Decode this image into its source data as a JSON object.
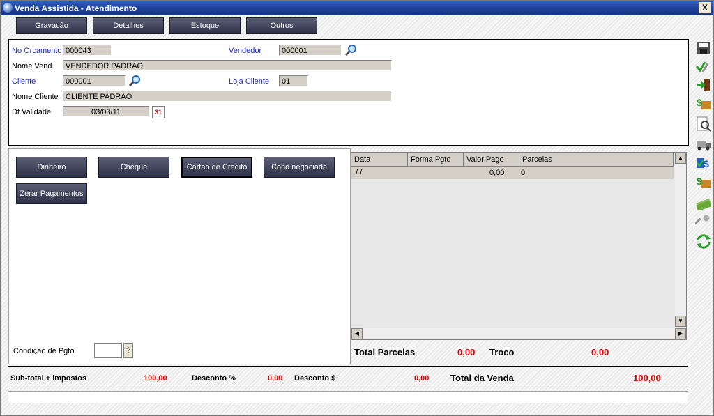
{
  "window": {
    "title": "Venda Assistida - Atendimento",
    "close_label": "X"
  },
  "toolbar": [
    "Gravacão",
    "Detalhes",
    "Estoque",
    "Outros"
  ],
  "form": {
    "orcamento_label": "No Orcamento",
    "orcamento_value": "000043",
    "vendedor_label": "Vendedor",
    "vendedor_value": "000001",
    "nome_vend_label": "Nome Vend.",
    "nome_vend_value": "VENDEDOR PADRAO",
    "cliente_label": "Cliente",
    "cliente_value": "000001",
    "loja_label": "Loja Cliente",
    "loja_value": "01",
    "nome_cliente_label": "Nome Cliente",
    "nome_cliente_value": "CLIENTE PADRAO",
    "validade_label": "Dt.Validade",
    "validade_value": "03/03/11",
    "calendar_icon_text": "31"
  },
  "payment": {
    "buttons": [
      "Dinheiro",
      "Cheque",
      "Cartao de Credito",
      "Cond.negociada"
    ],
    "zerar": "Zerar Pagamentos",
    "cond_label": "Condição de Pgto",
    "cond_value": "",
    "cond_help": "?"
  },
  "grid": {
    "headers": [
      "Data",
      "Forma Pgto",
      "Valor Pago",
      "Parcelas"
    ],
    "row": [
      "/ /",
      "",
      "0,00",
      "0"
    ]
  },
  "totals": {
    "total_parcelas_label": "Total Parcelas",
    "total_parcelas_value": "0,00",
    "troco_label": "Troco",
    "troco_value": "0,00",
    "subtotal_label": "Sub-total + impostos",
    "subtotal_value": "100,00",
    "desconto_pct_label": "Desconto %",
    "desconto_pct_value": "0,00",
    "desconto_val_label": "Desconto $",
    "desconto_val_value": "0,00",
    "total_venda_label": "Total da Venda",
    "total_venda_value": "100,00"
  },
  "sidebar_icons": [
    "save-icon",
    "check-tools-icon",
    "exit-door-icon",
    "money-box-icon",
    "preview-icon",
    "truck-icon",
    "check-dollar-icon",
    "money-box-2-icon",
    "cash-icon",
    "key-icon",
    "refresh-icon"
  ],
  "colors": {
    "title_bar": "#1d3f96",
    "button_dark": "#2e3147",
    "label_blue": "#1f2db5",
    "value_red": "#e00000"
  }
}
